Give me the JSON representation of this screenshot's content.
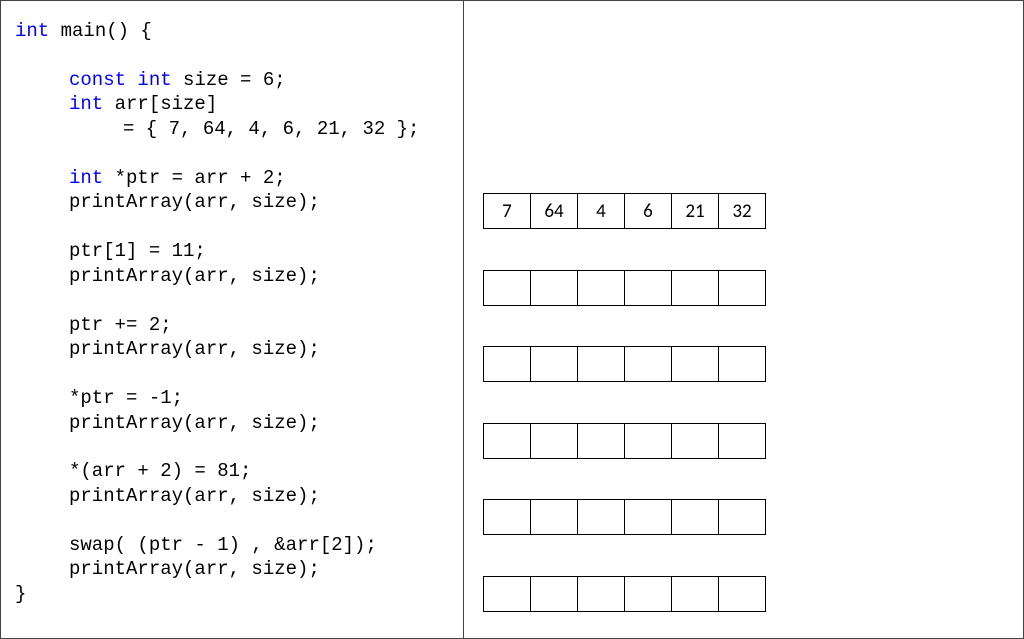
{
  "code": {
    "l1a": "int",
    "l1b": " main() {",
    "l2a": "const",
    "l2b": " ",
    "l2c": "int",
    "l2d": " size = 6;",
    "l3a": "int",
    "l3b": " arr[size]",
    "l4": "= { 7, 64, 4, 6, 21, 32 };",
    "l5a": "int",
    "l5b": " *ptr = arr + 2;",
    "l6": "printArray(arr, size);",
    "l7": "ptr[1] = 11;",
    "l8": "printArray(arr, size);",
    "l9": "ptr += 2;",
    "l10": "printArray(arr, size);",
    "l11": "*ptr = -1;",
    "l12": "printArray(arr, size);",
    "l13": "*(arr + 2) = 81;",
    "l14": "printArray(arr, size);",
    "l15": "swap( (ptr - 1) , &arr[2]);",
    "l16": "printArray(arr, size);",
    "l17": "}"
  },
  "arrays": [
    {
      "cells": [
        "7",
        "64",
        "4",
        "6",
        "21",
        "32"
      ]
    },
    {
      "cells": [
        "",
        "",
        "",
        "",
        "",
        ""
      ]
    },
    {
      "cells": [
        "",
        "",
        "",
        "",
        "",
        ""
      ]
    },
    {
      "cells": [
        "",
        "",
        "",
        "",
        "",
        ""
      ]
    },
    {
      "cells": [
        "",
        "",
        "",
        "",
        "",
        ""
      ]
    },
    {
      "cells": [
        "",
        "",
        "",
        "",
        "",
        ""
      ]
    }
  ]
}
